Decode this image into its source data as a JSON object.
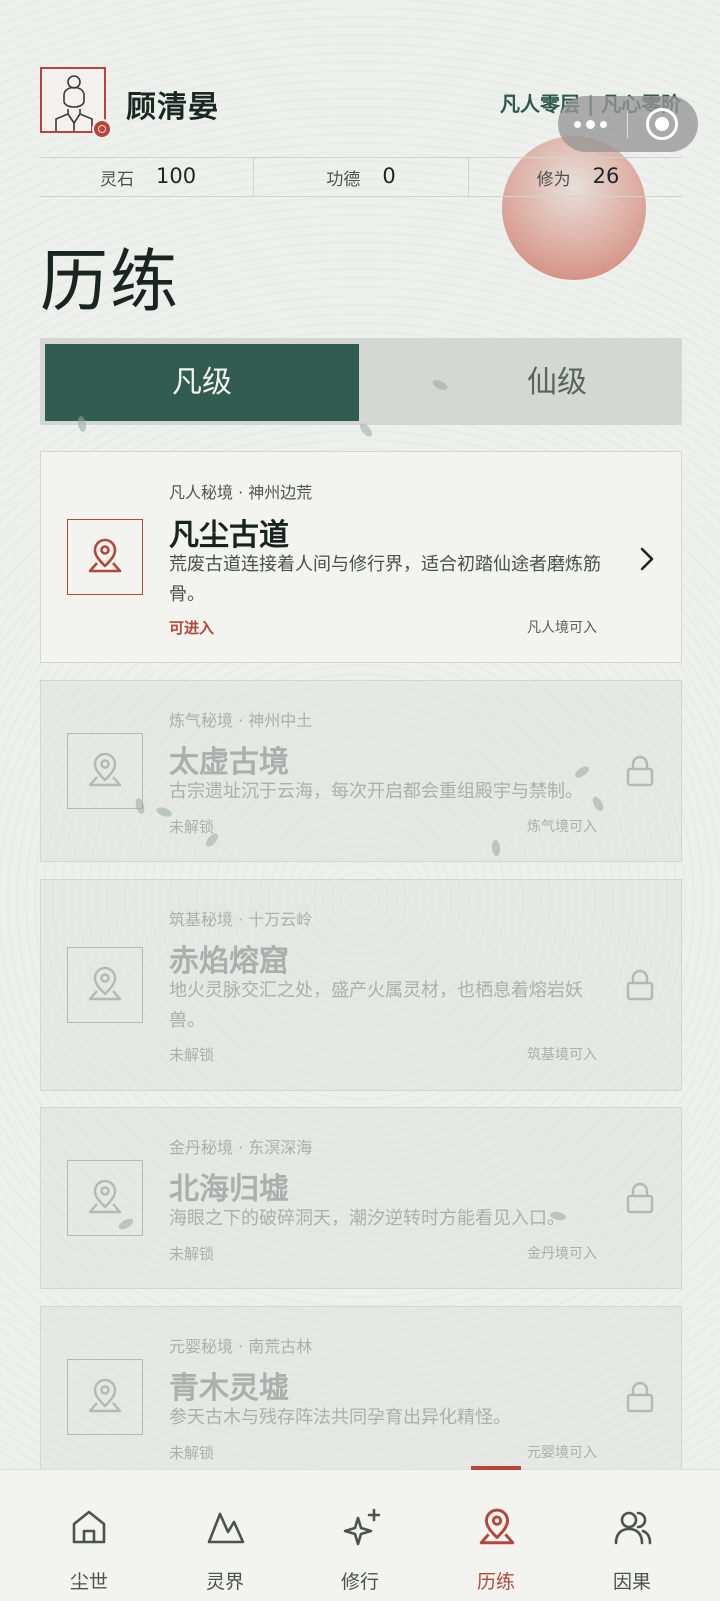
{
  "header": {
    "username": "顾清晏",
    "realm": "凡人零层 | 凡心零阶",
    "stats": [
      {
        "label": "灵石",
        "value": "100"
      },
      {
        "label": "功德",
        "value": "0"
      },
      {
        "label": "修为",
        "value": "26"
      }
    ]
  },
  "page": {
    "title": "历练"
  },
  "tabs": [
    {
      "label": "凡级",
      "active": true
    },
    {
      "label": "仙级",
      "active": false
    }
  ],
  "realms": [
    {
      "sub": "凡人秘境 · 神州边荒",
      "name": "凡尘古道",
      "desc": "荒废古道连接着人间与修行界，适合初踏仙途者磨炼筋骨。",
      "status": "可进入",
      "requirement": "凡人境可入",
      "locked": false
    },
    {
      "sub": "炼气秘境 · 神州中土",
      "name": "太虚古境",
      "desc": "古宗遗址沉于云海，每次开启都会重组殿宇与禁制。",
      "status": "未解锁",
      "requirement": "炼气境可入",
      "locked": true
    },
    {
      "sub": "筑基秘境 · 十万云岭",
      "name": "赤焰熔窟",
      "desc": "地火灵脉交汇之处，盛产火属灵材，也栖息着熔岩妖兽。",
      "status": "未解锁",
      "requirement": "筑基境可入",
      "locked": true
    },
    {
      "sub": "金丹秘境 · 东溟深海",
      "name": "北海归墟",
      "desc": "海眼之下的破碎洞天，潮汐逆转时方能看见入口。",
      "status": "未解锁",
      "requirement": "金丹境可入",
      "locked": true
    },
    {
      "sub": "元婴秘境 · 南荒古林",
      "name": "青木灵墟",
      "desc": "参天古木与残存阵法共同孕育出异化精怪。",
      "status": "未解锁",
      "requirement": "元婴境可入",
      "locked": true
    }
  ],
  "nav": [
    {
      "label": "尘世",
      "icon": "home-icon",
      "active": false
    },
    {
      "label": "灵界",
      "icon": "mountain-icon",
      "active": false
    },
    {
      "label": "修行",
      "icon": "sparkle-icon",
      "active": false
    },
    {
      "label": "历练",
      "icon": "map-pin-icon",
      "active": true
    },
    {
      "label": "因果",
      "icon": "users-icon",
      "active": false
    }
  ],
  "colors": {
    "accent": "#b5473a",
    "primary": "#325b52",
    "background": "#eef0ec"
  }
}
